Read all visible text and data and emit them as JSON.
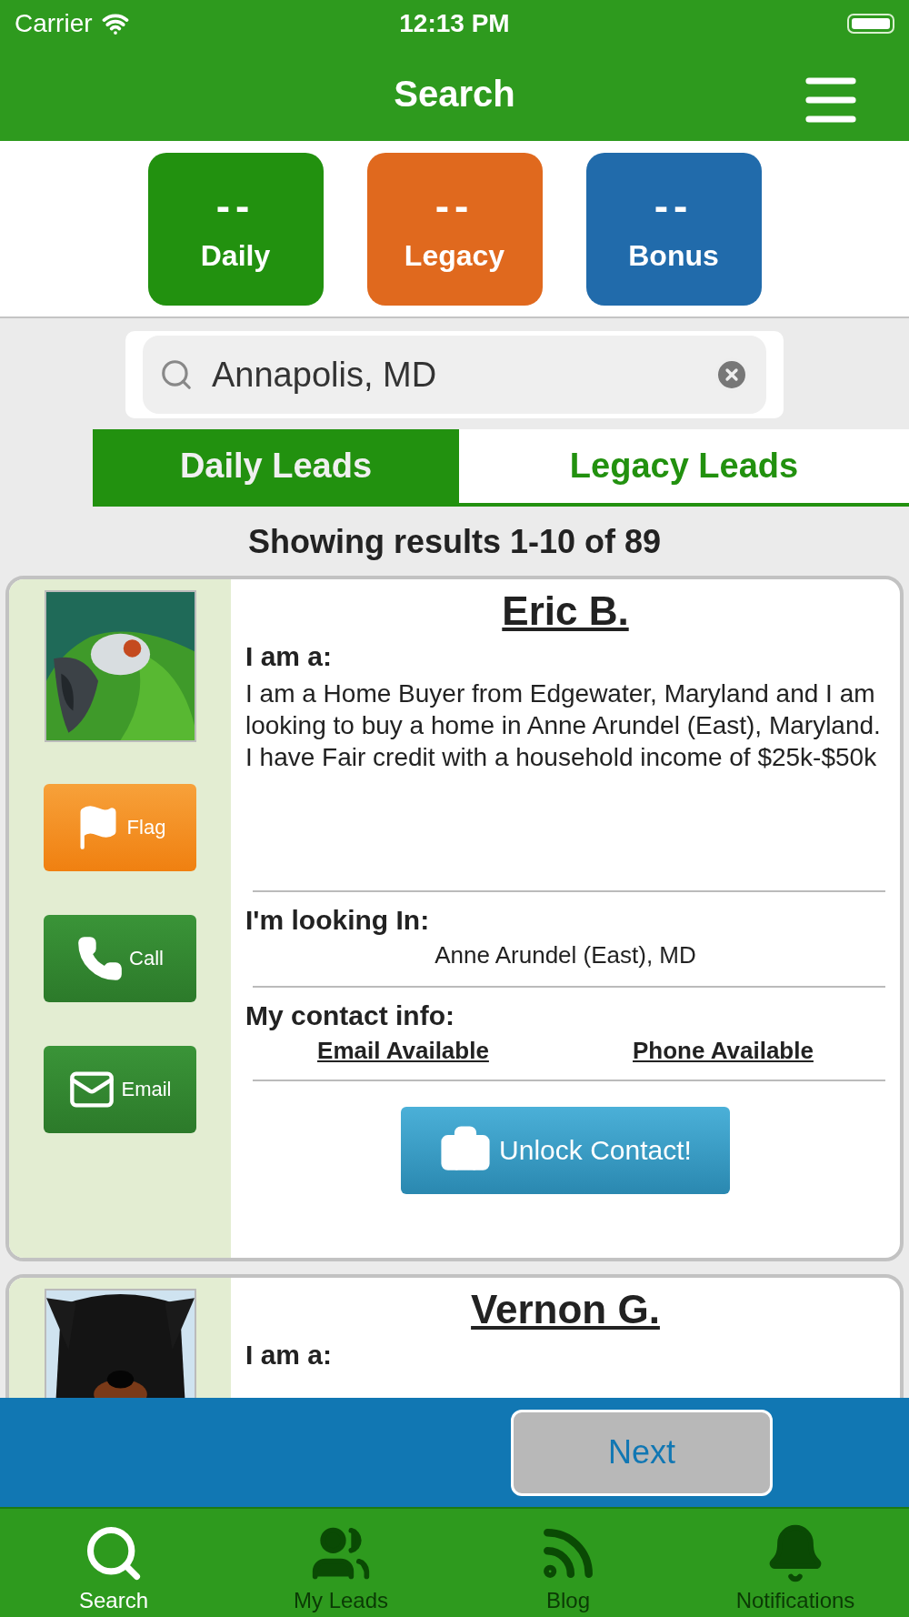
{
  "status_bar": {
    "carrier": "Carrier",
    "time": "12:13 PM"
  },
  "nav": {
    "title": "Search"
  },
  "stats": [
    {
      "value": "--",
      "label": "Daily",
      "color": "#22910f"
    },
    {
      "value": "--",
      "label": "Legacy",
      "color": "#e0691e"
    },
    {
      "value": "--",
      "label": "Bonus",
      "color": "#216bab"
    }
  ],
  "search": {
    "value": "Annapolis, MD"
  },
  "lead_tabs": [
    {
      "label": "Daily Leads",
      "selected": true
    },
    {
      "label": "Legacy Leads",
      "selected": false
    }
  ],
  "results_summary": "Showing results 1-10 of 89",
  "leads": [
    {
      "name": "Eric B.",
      "actions": [
        {
          "kind": "flag",
          "label": "Flag"
        },
        {
          "kind": "call",
          "label": "Call"
        },
        {
          "kind": "email",
          "label": "Email"
        }
      ],
      "about_label": "I am a:",
      "about": "I am a Home Buyer from Edgewater, Maryland and I am looking to buy a home in Anne Arundel (East), Maryland. I have Fair credit with a household income of $25k-$50k",
      "location_label": "I'm looking In:",
      "location": "Anne Arundel (East), MD",
      "contact_label": "My contact info:",
      "contact": [
        "Email Available",
        "Phone Available"
      ],
      "unlock": "Unlock Contact!"
    },
    {
      "name": "Vernon G.",
      "about_label": "I am a:"
    }
  ],
  "pager": {
    "next": "Next"
  },
  "tab_bar": [
    {
      "kind": "search",
      "label": "Search",
      "selected": true
    },
    {
      "kind": "leads",
      "label": "My Leads",
      "selected": false
    },
    {
      "kind": "blog",
      "label": "Blog",
      "selected": false
    },
    {
      "kind": "notifications",
      "label": "Notifications",
      "selected": false
    }
  ]
}
